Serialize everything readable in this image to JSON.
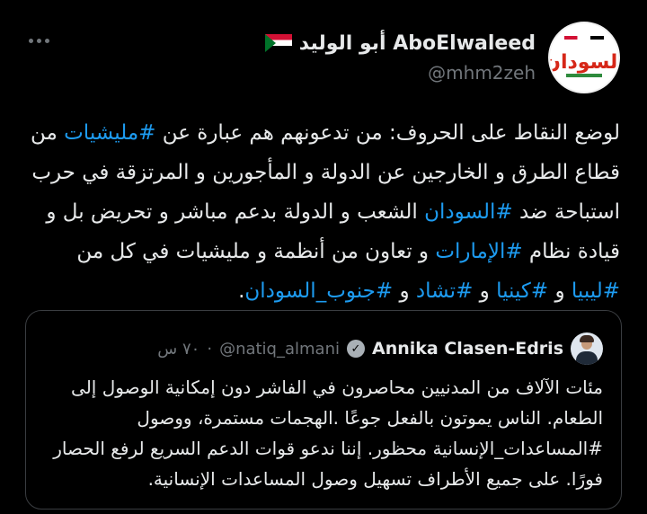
{
  "tweet": {
    "display_name": "AboElwaleed أبو الوليد",
    "handle": "@mhm2zeh",
    "avatar_logo_text": "السودان",
    "text_parts": [
      {
        "text": "لوضع النقاط على الحروف: من تدعونهم هم عبارة عن ",
        "tag": false
      },
      {
        "text": "#مليشيات",
        "tag": true
      },
      {
        "text": " من قطاع الطرق و الخارجين عن الدولة و المأجورين و المرتزقة في حرب استباحة ضد ",
        "tag": false
      },
      {
        "text": "#السودان",
        "tag": true
      },
      {
        "text": " الشعب و الدولة بدعم مباشر و تحريض بل و قيادة نظام ",
        "tag": false
      },
      {
        "text": "#الإمارات",
        "tag": true
      },
      {
        "text": " و تعاون من أنظمة و مليشيات في كل من ",
        "tag": false
      },
      {
        "text": "#ليبيا",
        "tag": true
      },
      {
        "text": " و ",
        "tag": false
      },
      {
        "text": "#كينيا",
        "tag": true
      },
      {
        "text": " و ",
        "tag": false
      },
      {
        "text": "#تشاد",
        "tag": true
      },
      {
        "text": " و ",
        "tag": false
      },
      {
        "text": "#جنوب_السودان",
        "tag": true
      },
      {
        "text": ".",
        "tag": false
      }
    ]
  },
  "quote": {
    "name": "Annika Clasen-Edris",
    "handle": "@natiq_almani",
    "dot": "·",
    "time": "٧٠ س",
    "text": "مئات الآلاف من المدنيين محاصرون في الفاشر دون إمكانية الوصول إلى الطعام. الناس يموتون بالفعل جوعًا .الهجمات مستمرة، ووصول #المساعدات_الإنسانية محظور. إننا ندعو قوات الدعم السريع لرفع الحصار فورًا. على جميع الأطراف تسهيل وصول المساعدات الإنسانية."
  },
  "colors": {
    "background": "#000000",
    "text": "#e7e9ea",
    "secondary": "#71767b",
    "link": "#1d9bf0"
  },
  "icons": {
    "more": "more-horizontal-icon",
    "flag": "sudan-flag-icon",
    "verified": "verified-badge-icon"
  }
}
